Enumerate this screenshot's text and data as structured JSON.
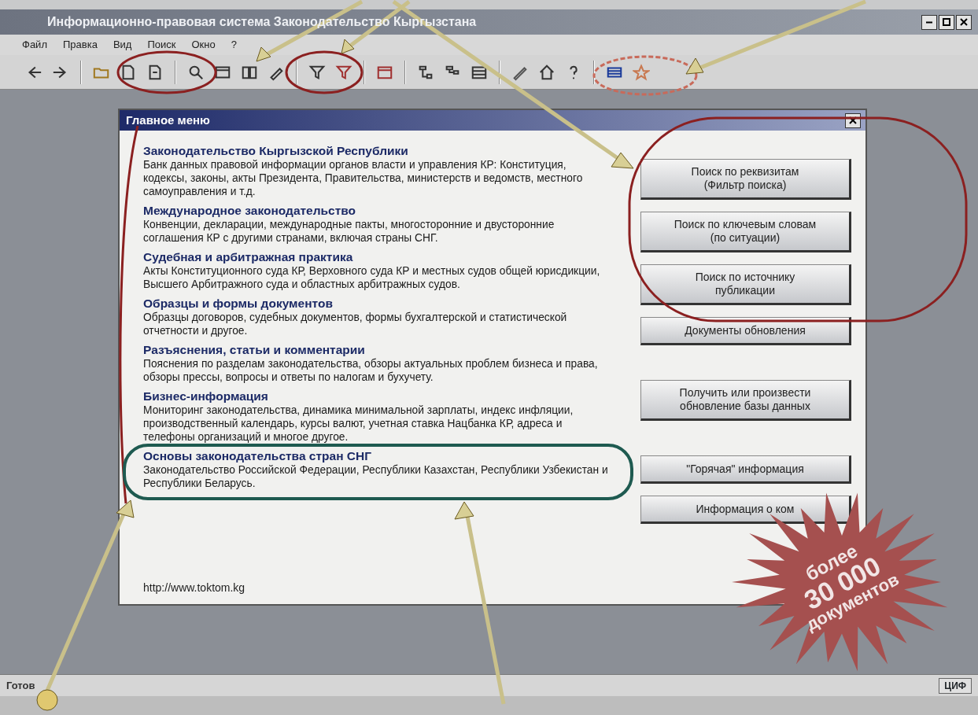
{
  "window": {
    "title": "Информационно-правовая система Законодательство Кыргызстана"
  },
  "menu": [
    "Файл",
    "Правка",
    "Вид",
    "Поиск",
    "Окно",
    "?"
  ],
  "dialog": {
    "title": "Главное меню",
    "sections": [
      {
        "heading": "Законодательство Кыргызской Республики",
        "text": "Банк данных правовой информации органов власти и управления КР: Конституция, кодексы, законы, акты Президента, Правительства, министерств и ведомств, местного самоуправления и т.д."
      },
      {
        "heading": "Международное законодательство",
        "text": "Конвенции, декларации, международные пакты, многосторонние и двусторонние соглашения КР с другими странами, включая страны СНГ."
      },
      {
        "heading": "Судебная и арбитражная практика",
        "text": "Акты Конституционного суда КР, Верховного суда КР и местных судов общей юрисдикции, Высшего Арбитражного суда и областных арбитражных судов."
      },
      {
        "heading": "Образцы и формы документов",
        "text": "Образцы договоров, судебных документов, формы бухгалтерской и статистической отчетности и другое."
      },
      {
        "heading": "Разъяснения, статьи и комментарии",
        "text": "Пояснения по разделам законодательства, обзоры актуальных проблем бизнеса и права, обзоры прессы, вопросы и ответы по налогам и бухучету."
      },
      {
        "heading": "Бизнес-информация",
        "text": "Мониторинг законодательства, динамика минимальной зарплаты, индекс инфляции, производственный календарь, курсы валют, учетная ставка Нацбанка КР, адреса и телефоны организаций и многое другое."
      },
      {
        "heading": "Основы законодательства стран СНГ",
        "text": "Законодательство Российской Федерации, Республики Казахстан, Республики Узбекистан и Республики Беларусь."
      }
    ],
    "url": "http://www.toktom.kg",
    "button_groups": [
      [
        "Поиск по реквизитам (Фильтр поиска)",
        "Поиск по ключевым словам (по ситуации)",
        "Поиск по источнику публикации",
        "Документы обновления"
      ],
      [
        "Получить или произвести обновление базы данных"
      ],
      [
        "\"Горячая\" информация",
        "Информация о ком"
      ]
    ]
  },
  "badge": [
    "более",
    "30 000",
    "документов"
  ],
  "status_bar": {
    "text": "Готов",
    "indicator": "ЦИФ"
  }
}
